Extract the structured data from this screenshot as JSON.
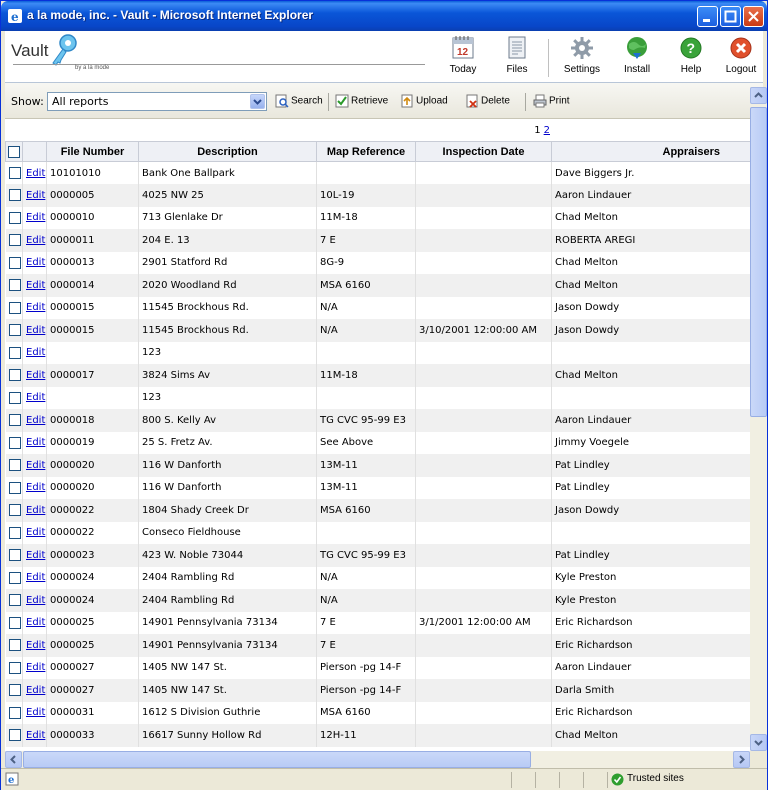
{
  "window": {
    "title": "a la mode, inc. - Vault - Microsoft Internet Explorer"
  },
  "app": {
    "logo_text": "Vault",
    "logo_subtext": "by a la mode"
  },
  "nav": [
    {
      "key": "today",
      "label": "Today",
      "icon": "calendar-icon"
    },
    {
      "key": "files",
      "label": "Files",
      "icon": "document-icon"
    },
    {
      "key": "settings",
      "label": "Settings",
      "icon": "gear-icon"
    },
    {
      "key": "install",
      "label": "Install",
      "icon": "install-globe-icon"
    },
    {
      "key": "help",
      "label": "Help",
      "icon": "help-icon"
    },
    {
      "key": "logout",
      "label": "Logout",
      "icon": "logout-icon"
    }
  ],
  "calendar_day": "12",
  "toolbar": {
    "show_label": "Show:",
    "show_value": "All reports",
    "search": "Search",
    "retrieve": "Retrieve",
    "upload": "Upload",
    "delete": "Delete",
    "print": "Print"
  },
  "pager": {
    "current": "1",
    "next": "2"
  },
  "columns": [
    "File Number",
    "Description",
    "Map Reference",
    "Inspection Date",
    "Appraisers"
  ],
  "edit_label": "Edit",
  "rows": [
    [
      "10101010",
      "Bank One Ballpark",
      "",
      "",
      "Dave Biggers Jr."
    ],
    [
      "0000005",
      "4025 NW 25",
      "10L-19",
      "",
      "Aaron Lindauer"
    ],
    [
      "0000010",
      "713 Glenlake Dr",
      "11M-18",
      "",
      "Chad Melton"
    ],
    [
      "0000011",
      "204 E. 13",
      "7 E",
      "",
      "ROBERTA AREGI"
    ],
    [
      "0000013",
      "2901 Statford Rd",
      "8G-9",
      "",
      "Chad Melton"
    ],
    [
      "0000014",
      "2020 Woodland Rd",
      "MSA 6160",
      "",
      "Chad Melton"
    ],
    [
      "0000015",
      "11545 Brockhous Rd.",
      "N/A",
      "",
      "Jason Dowdy"
    ],
    [
      "0000015",
      "11545 Brockhous Rd.",
      "N/A",
      "3/10/2001 12:00:00 AM",
      "Jason Dowdy"
    ],
    [
      "",
      "123",
      "",
      "",
      ""
    ],
    [
      "0000017",
      "3824 Sims Av",
      "11M-18",
      "",
      "Chad Melton"
    ],
    [
      "",
      "123",
      "",
      "",
      ""
    ],
    [
      "0000018",
      "800 S. Kelly Av",
      "TG CVC 95-99 E3",
      "",
      "Aaron Lindauer"
    ],
    [
      "0000019",
      "25 S. Fretz Av.",
      "See Above",
      "",
      "Jimmy Voegele"
    ],
    [
      "0000020",
      "116 W Danforth",
      "13M-11",
      "",
      "Pat Lindley"
    ],
    [
      "0000020",
      "116 W Danforth",
      "13M-11",
      "",
      "Pat Lindley"
    ],
    [
      "0000022",
      "1804 Shady Creek Dr",
      "MSA 6160",
      "",
      "Jason Dowdy"
    ],
    [
      "0000022",
      "Conseco Fieldhouse",
      "",
      "",
      ""
    ],
    [
      "0000023",
      "423 W. Noble 73044",
      "TG CVC 95-99 E3",
      "",
      "Pat Lindley"
    ],
    [
      "0000024",
      "2404 Rambling Rd",
      "N/A",
      "",
      "Kyle Preston"
    ],
    [
      "0000024",
      "2404 Rambling Rd",
      "N/A",
      "",
      "Kyle Preston"
    ],
    [
      "0000025",
      "14901 Pennsylvania 73134",
      "7 E",
      "3/1/2001 12:00:00 AM",
      "Eric Richardson"
    ],
    [
      "0000025",
      "14901 Pennsylvania 73134",
      "7 E",
      "",
      "Eric Richardson"
    ],
    [
      "0000027",
      "1405 NW 147 St.",
      "Pierson -pg 14-F",
      "",
      "Aaron Lindauer"
    ],
    [
      "0000027",
      "1405 NW 147 St.",
      "Pierson -pg 14-F",
      "",
      "Darla Smith"
    ],
    [
      "0000031",
      "1612 S Division Guthrie",
      "MSA 6160",
      "",
      "Eric Richardson"
    ],
    [
      "0000033",
      "16617 Sunny Hollow Rd",
      "12H-11",
      "",
      "Chad Melton"
    ]
  ],
  "status": {
    "zone": "Trusted sites"
  },
  "colors": {
    "titlebar": "#0a56d8",
    "link": "#0000cc",
    "row_alt": "#f0f0f0"
  }
}
